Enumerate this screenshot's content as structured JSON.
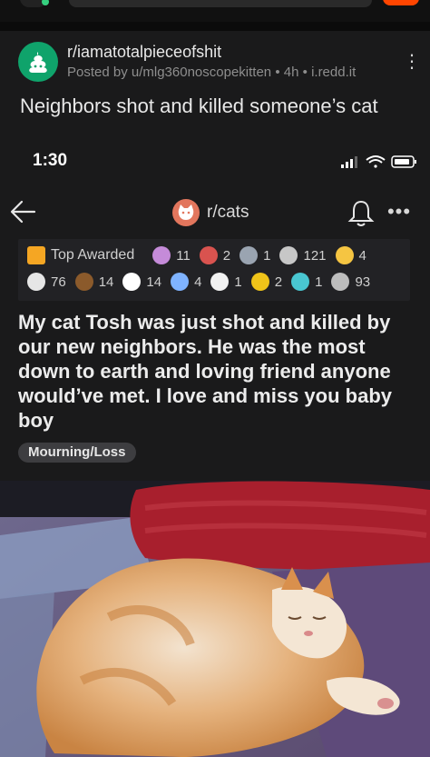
{
  "outer_post": {
    "subreddit": "r/iamatotalpieceofshit",
    "posted_by": "Posted by u/mlg360noscopekitten",
    "time": "4h",
    "domain": "i.redd.it",
    "separator": "•",
    "title": "Neighbors shot and killed someone’s cat"
  },
  "embedded": {
    "status_time": "1:30",
    "subreddit": "r/cats",
    "awards": {
      "label": "Top Awarded",
      "row1": [
        {
          "icon": "cheers-icon",
          "count": "11",
          "color": "#e8b3ff"
        },
        {
          "icon": "heart-eyes-icon",
          "count": "2",
          "color": "#d9534f"
        },
        {
          "icon": "wholesome-icon",
          "count": "1",
          "color": "#9aa4b1"
        },
        {
          "icon": "silver-icon",
          "count": "121",
          "color": "#c7c7c7"
        },
        {
          "icon": "gold-icon",
          "count": "4",
          "color": "#f5c542"
        }
      ],
      "row2": [
        {
          "icon": "hug-icon",
          "count": "76",
          "color": "#e6e6e6"
        },
        {
          "icon": "poop-icon",
          "count": "14",
          "color": "#8b5a2b"
        },
        {
          "icon": "helpful-icon",
          "count": "14",
          "color": "#ffffff"
        },
        {
          "icon": "ally-icon",
          "count": "4",
          "color": "#7fb3ff"
        },
        {
          "icon": "lol-icon",
          "count": "1",
          "color": "#ffffff"
        },
        {
          "icon": "clap-icon",
          "count": "2",
          "color": "#f0c419"
        },
        {
          "icon": "platinum-icon",
          "count": "1",
          "color": "#49c6d1"
        },
        {
          "icon": "handshake-icon",
          "count": "93",
          "color": "#bdbdbd"
        }
      ]
    },
    "post_title": "My cat Tosh was just shot and killed by our new neighbors. He was the most down to earth and loving friend anyone would’ve met. I love and miss you baby boy",
    "flair": "Mourning/Loss"
  },
  "colors": {
    "background": "#1a1a1b",
    "subreddit_avatar": "#0fa36b",
    "accent": "#ff4500"
  }
}
